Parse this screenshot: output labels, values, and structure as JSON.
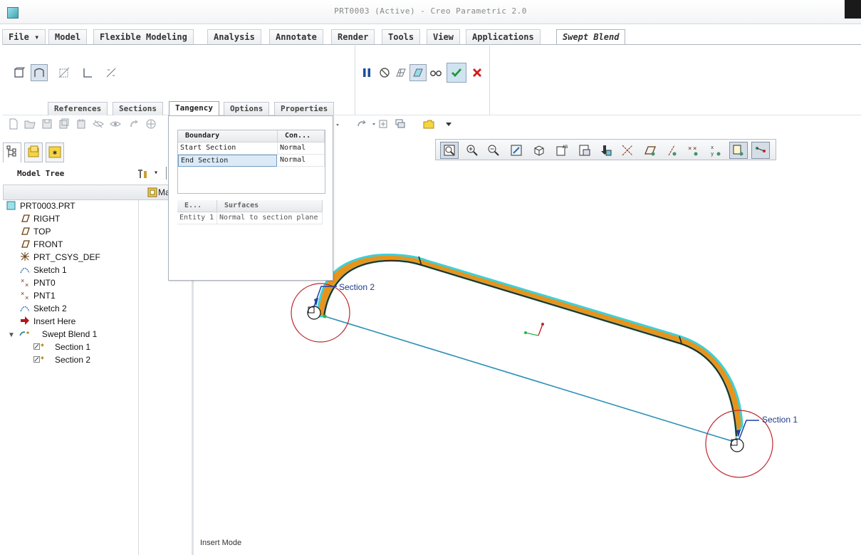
{
  "window": {
    "title": "PRT0003 (Active) - Creo Parametric 2.0"
  },
  "menu_tabs": [
    {
      "label": "File ▾"
    },
    {
      "label": "Model"
    },
    {
      "label": "Flexible Modeling"
    },
    {
      "label": "Analysis"
    },
    {
      "label": "Annotate"
    },
    {
      "label": "Render"
    },
    {
      "label": "Tools"
    },
    {
      "label": "View"
    },
    {
      "label": "Applications"
    },
    {
      "label": "Swept Blend"
    }
  ],
  "dashboard_tabs": [
    {
      "label": "References"
    },
    {
      "label": "Sections"
    },
    {
      "label": "Tangency"
    },
    {
      "label": "Options"
    },
    {
      "label": "Properties"
    }
  ],
  "tangency_panel": {
    "headers": {
      "boundary": "Boundary",
      "condition": "Con..."
    },
    "rows": [
      {
        "boundary": "Start Section",
        "condition": "Normal"
      },
      {
        "boundary": "End Section",
        "condition": "Normal"
      }
    ],
    "sub_headers": {
      "entity": "E...",
      "surfaces": "Surfaces"
    },
    "sub_rows": [
      {
        "entity": "Entity 1",
        "surfaces": "Normal to section plane"
      }
    ]
  },
  "navigator": {
    "title": "Model Tree",
    "column_label": "Ma"
  },
  "model_tree": [
    {
      "label": "PRT0003.PRT",
      "icon": "part-icon"
    },
    {
      "label": "RIGHT",
      "icon": "datum-plane-icon"
    },
    {
      "label": "TOP",
      "icon": "datum-plane-icon"
    },
    {
      "label": "FRONT",
      "icon": "datum-plane-icon"
    },
    {
      "label": "PRT_CSYS_DEF",
      "icon": "csys-icon"
    },
    {
      "label": "Sketch 1",
      "icon": "sketch-icon"
    },
    {
      "label": "PNT0",
      "icon": "datum-point-icon"
    },
    {
      "label": "PNT1",
      "icon": "datum-point-icon"
    },
    {
      "label": "Sketch 2",
      "icon": "sketch-icon"
    },
    {
      "label": "Insert Here",
      "icon": "insert-arrow-icon"
    },
    {
      "label": "Swept Blend 1",
      "icon": "swept-blend-icon"
    },
    {
      "label": "Section 1",
      "icon": "section-sketch-icon"
    },
    {
      "label": "Section 2",
      "icon": "section-sketch-icon"
    }
  ],
  "viewport": {
    "section_labels": {
      "section_2": "Section 2",
      "section_1": "Section 1"
    },
    "status": "Insert Mode"
  },
  "colors": {
    "accent": "#e8941a",
    "cyan_edge": "#3fd0d8",
    "circle": "#c0262c",
    "line": "#2a8fb5"
  }
}
